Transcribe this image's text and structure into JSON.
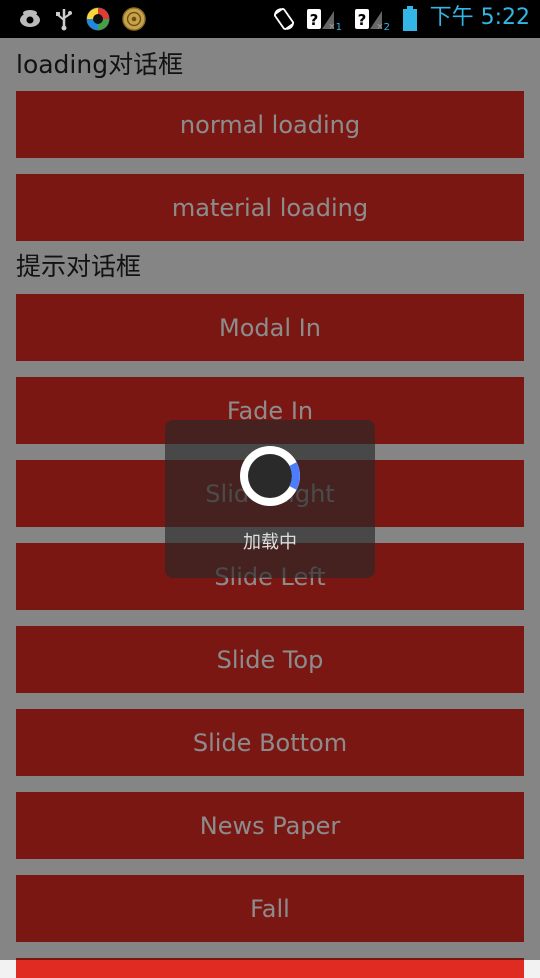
{
  "status_bar": {
    "time": "下午 5:22",
    "sim1_label": "1",
    "sim2_label": "2",
    "icons": [
      "eye-icon",
      "usb-icon",
      "app-icon",
      "coin-icon",
      "rotation-icon",
      "sim1-signal-icon",
      "sim2-signal-icon",
      "battery-icon"
    ]
  },
  "sections": {
    "loading_title": "loading对话框",
    "prompt_title": "提示对话框"
  },
  "buttons": {
    "normal_loading": "normal loading",
    "material_loading": "material loading",
    "modal_in": "Modal In",
    "fade_in": "Fade In",
    "slide_right": "Slide Right",
    "slide_left": "Slide Left",
    "slide_top": "Slide Top",
    "slide_bottom": "Slide Bottom",
    "news_paper": "News Paper",
    "fall": "Fall"
  },
  "dialog": {
    "loading_text": "加载中"
  },
  "colors": {
    "button_bg": "#e02b23",
    "status_accent": "#33b5e5",
    "spinner_accent": "#4d7cfe"
  }
}
